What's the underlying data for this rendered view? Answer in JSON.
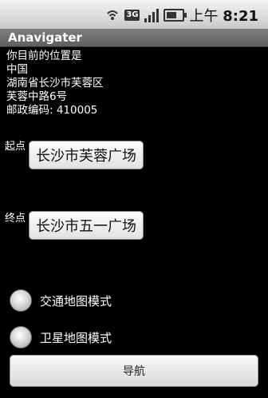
{
  "status_bar": {
    "icons": [
      "wifi-icon",
      "network-badge-icon",
      "signal-icon",
      "battery-icon"
    ],
    "network_badge": "3G",
    "time_prefix": "上午",
    "time": "8:21"
  },
  "app": {
    "title": "Anavigater"
  },
  "location": {
    "label": "你目前的位置是",
    "country": "中国",
    "address": "湖南省长沙市芙蓉区",
    "street": "芙蓉中路6号",
    "postcode": "邮政编码: 410005"
  },
  "route": {
    "start_label": "起点",
    "start_value": "长沙市芙蓉广场",
    "end_label": "终点",
    "end_value": "长沙市五一广场"
  },
  "map_modes": {
    "options": [
      "交通地图模式",
      "卫星地图模式"
    ]
  },
  "actions": {
    "navigate_label": "导航"
  }
}
